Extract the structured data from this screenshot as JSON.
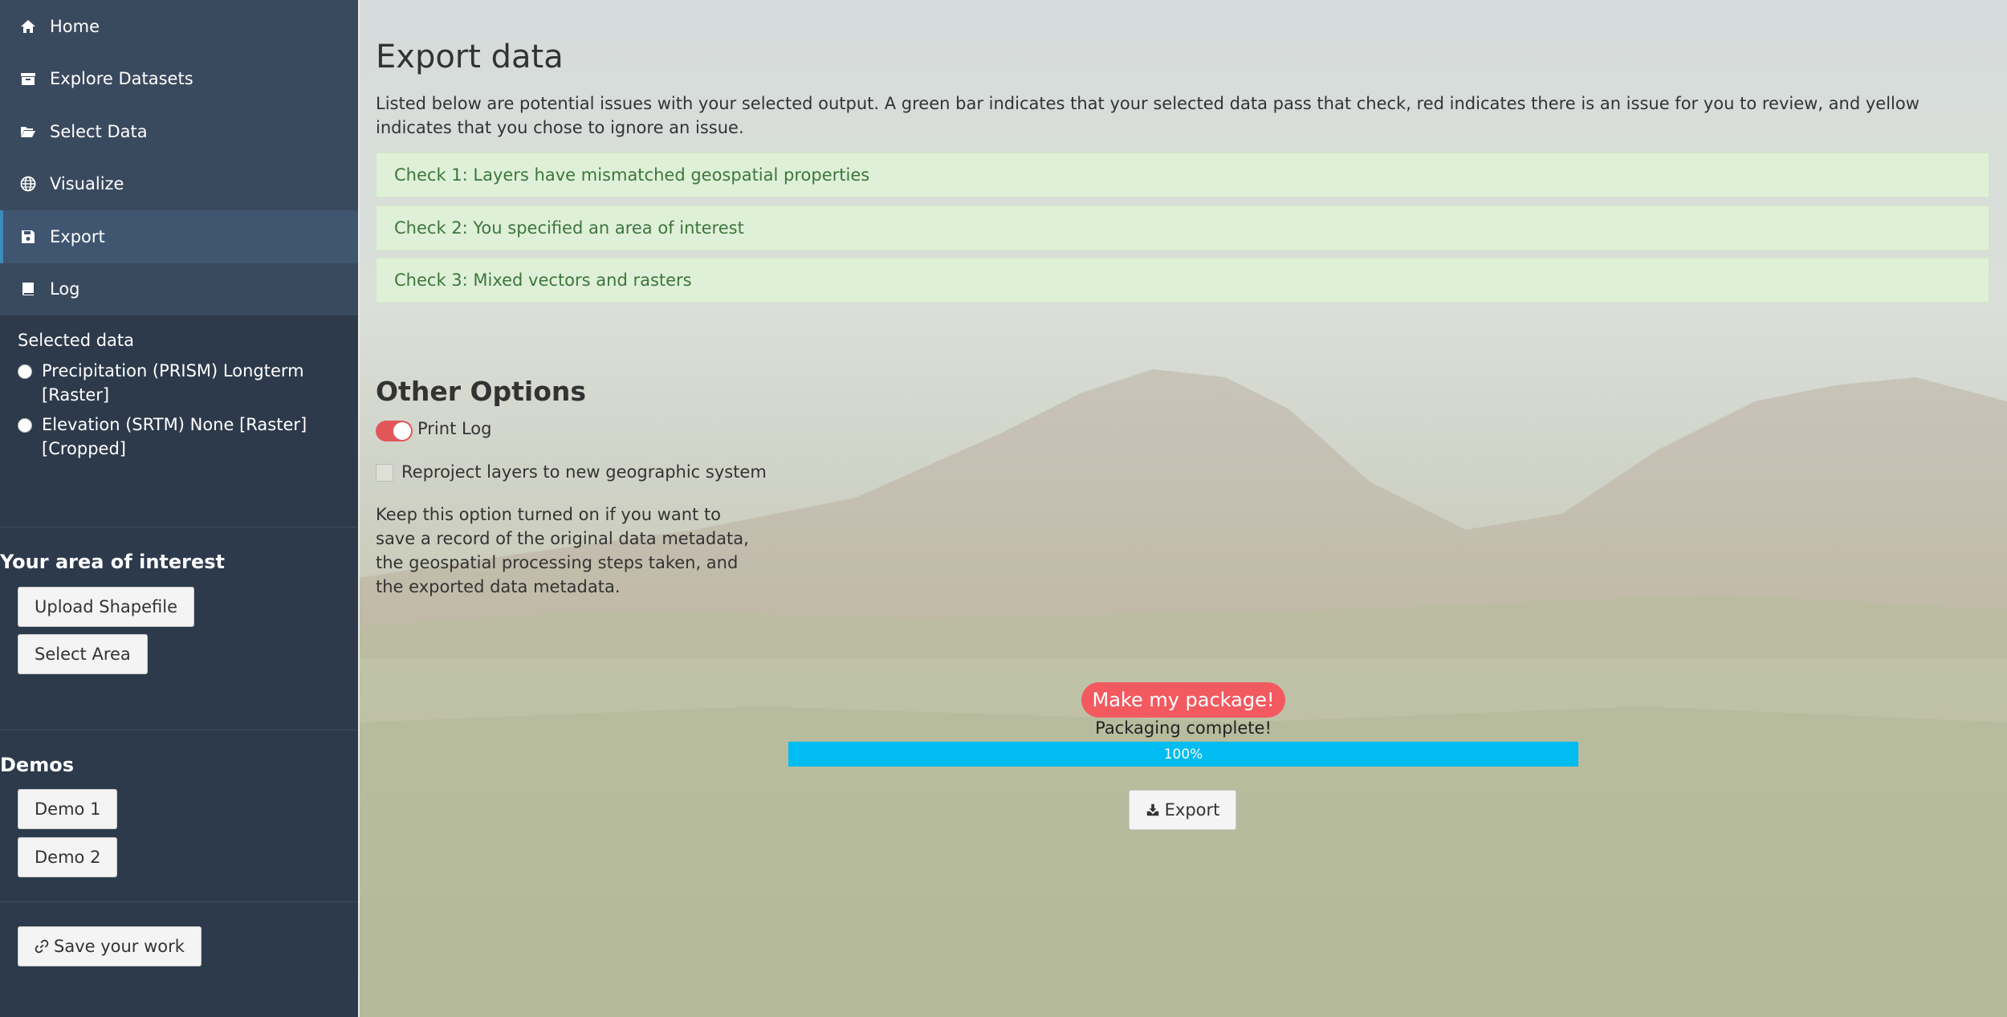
{
  "sidebar": {
    "nav": [
      {
        "label": "Home",
        "icon": "home-icon"
      },
      {
        "label": "Explore Datasets",
        "icon": "archive-icon"
      },
      {
        "label": "Select Data",
        "icon": "folder-open-icon"
      },
      {
        "label": "Visualize",
        "icon": "globe-icon"
      },
      {
        "label": "Export",
        "icon": "save-icon"
      },
      {
        "label": "Log",
        "icon": "book-icon"
      }
    ],
    "selected_title": "Selected data",
    "selected_items": [
      "Precipitation (PRISM) Longterm [Raster]",
      "Elevation (SRTM) None [Raster] [Cropped]"
    ],
    "aoi_title": "Your area of interest",
    "upload_label": "Upload Shapefile",
    "select_area_label": "Select Area",
    "demos_title": "Demos",
    "demo1_label": "Demo 1",
    "demo2_label": "Demo 2",
    "save_label": "Save your work"
  },
  "main": {
    "title": "Export data",
    "intro": "Listed below are potential issues with your selected output. A green bar indicates that your selected data pass that check, red indicates there is an issue for you to review, and yellow indicates that you chose to ignore an issue.",
    "checks": [
      "Check 1: Layers have mismatched geospatial properties",
      "Check 2: You specified an area of interest",
      "Check 3: Mixed vectors and rasters"
    ],
    "other_title": "Other Options",
    "print_log_label": "Print Log",
    "reproject_label": "Reproject layers to new geographic system",
    "help_text": "Keep this option turned on if you want to save a record of the original data metadata, the geospatial processing steps taken, and the exported data metadata.",
    "make_package_label": "Make my package!",
    "status": "Packaging complete!",
    "progress_text": "100%",
    "progress_value": 1.0,
    "export_label": "Export"
  },
  "colors": {
    "sidebar_bg": "#2c3a4b",
    "check_pass": "#dff0d8",
    "accent_red": "#f25a60",
    "progress": "#00bcf0"
  }
}
